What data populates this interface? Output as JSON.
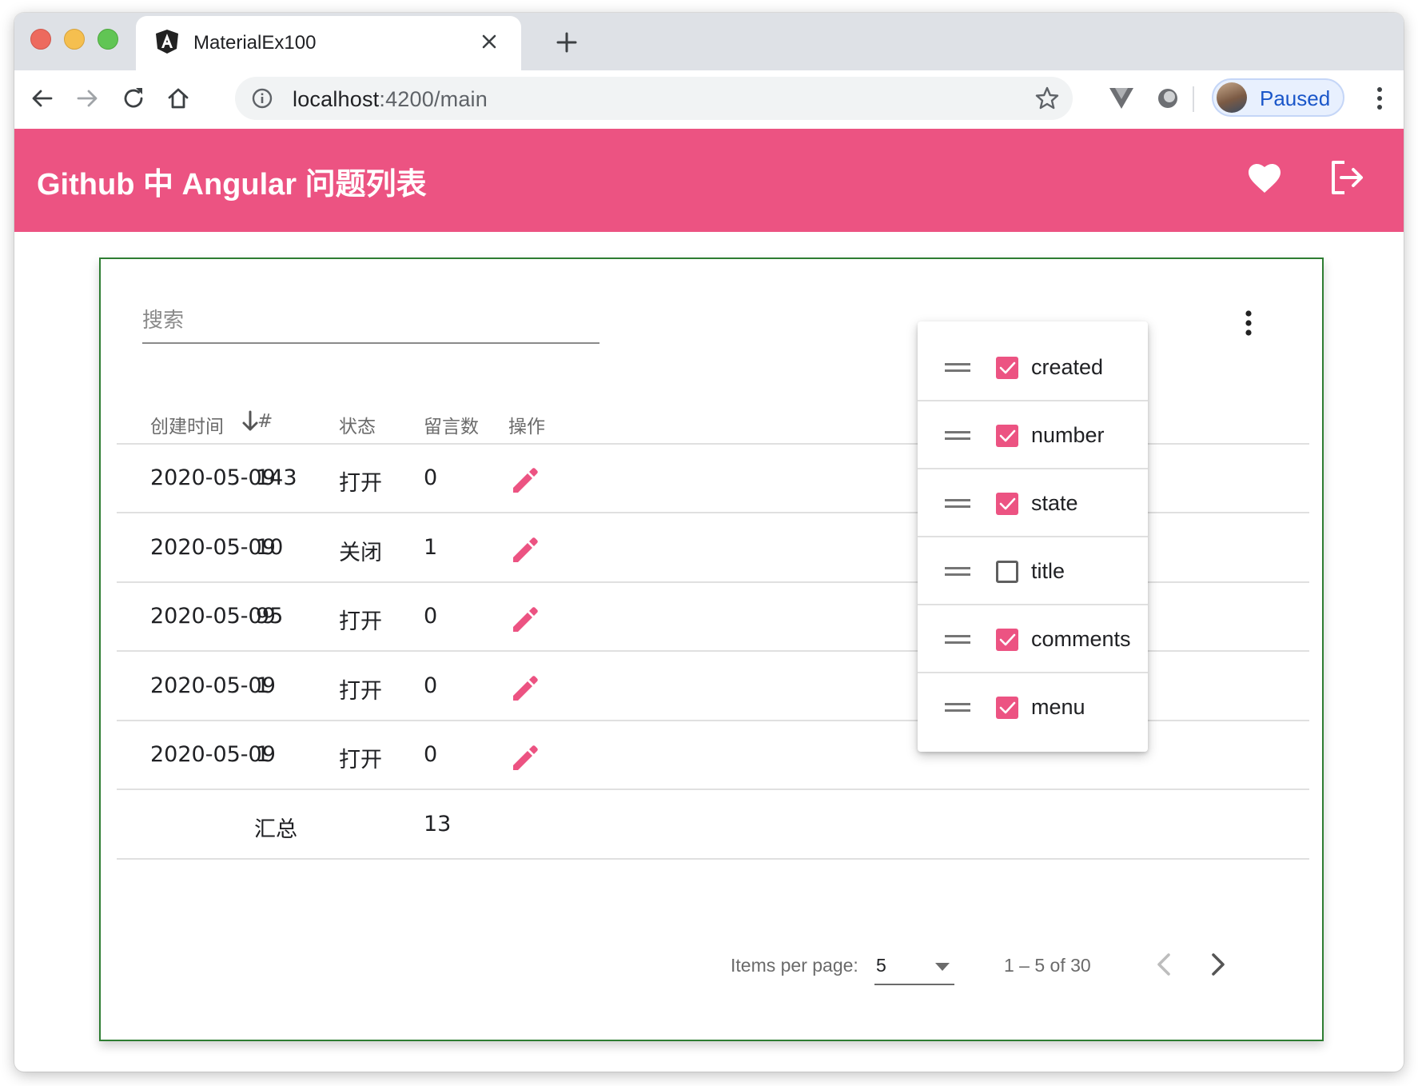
{
  "browser": {
    "tab_title": "MaterialEx100",
    "url_host": "localhost",
    "url_path": ":4200/main",
    "profile_status": "Paused",
    "accent": "#1a56c9"
  },
  "app": {
    "title": "Github 中 Angular 问题列表",
    "bar_color": "#ec5382",
    "icons": [
      "favorite-icon",
      "logout-icon"
    ]
  },
  "search": {
    "placeholder": "搜索",
    "value": ""
  },
  "table": {
    "headers": {
      "created": "创建时间",
      "number": "#",
      "state": "状态",
      "comments": "留言数",
      "menu": "操作"
    },
    "sort": {
      "column": "created",
      "direction": "desc"
    },
    "rows": [
      {
        "created": "2020-05-09",
        "number": "143",
        "state": "打开",
        "comments": "0"
      },
      {
        "created": "2020-05-09",
        "number": "10",
        "state": "关闭",
        "comments": "1"
      },
      {
        "created": "2020-05-09",
        "number": "95",
        "state": "打开",
        "comments": "0"
      },
      {
        "created": "2020-05-09",
        "number": "1",
        "state": "打开",
        "comments": "0"
      },
      {
        "created": "2020-05-09",
        "number": "1",
        "state": "打开",
        "comments": "0"
      }
    ],
    "footer": {
      "label": "汇总",
      "comments_total": "13"
    }
  },
  "paginator": {
    "items_per_page_label": "Items per page:",
    "page_size": "5",
    "range_label": "1 – 5 of 30"
  },
  "column_menu": {
    "items": [
      {
        "label": "created",
        "checked": true
      },
      {
        "label": "number",
        "checked": true
      },
      {
        "label": "state",
        "checked": true
      },
      {
        "label": "title",
        "checked": false
      },
      {
        "label": "comments",
        "checked": true
      },
      {
        "label": "menu",
        "checked": true
      }
    ]
  }
}
